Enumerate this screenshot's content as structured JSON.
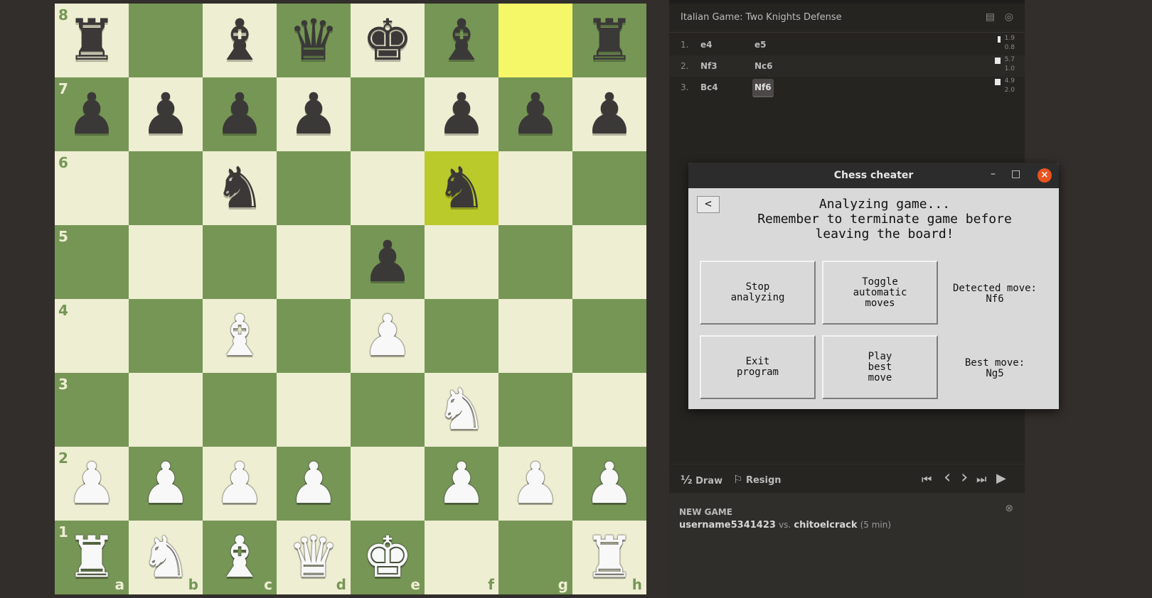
{
  "board": {
    "ranks": [
      "8",
      "7",
      "6",
      "5",
      "4",
      "3",
      "2",
      "1"
    ],
    "files": [
      "a",
      "b",
      "c",
      "d",
      "e",
      "f",
      "g",
      "h"
    ],
    "rows": [
      [
        "bR",
        "",
        "bB",
        "bQ",
        "bK",
        "bB",
        "",
        "bR"
      ],
      [
        "bP",
        "bP",
        "bP",
        "bP",
        "",
        "bP",
        "bP",
        "bP"
      ],
      [
        "",
        "",
        "bN",
        "",
        "",
        "bN",
        "",
        ""
      ],
      [
        "",
        "",
        "",
        "",
        "bP",
        "",
        "",
        ""
      ],
      [
        "",
        "",
        "wB",
        "",
        "wP",
        "",
        "",
        ""
      ],
      [
        "",
        "",
        "",
        "",
        "",
        "wN",
        "",
        ""
      ],
      [
        "wP",
        "wP",
        "wP",
        "wP",
        "",
        "wP",
        "wP",
        "wP"
      ],
      [
        "wR",
        "wN",
        "wB",
        "wQ",
        "wK",
        "",
        "",
        "wR"
      ]
    ],
    "highlight": [
      "g8",
      "f6"
    ],
    "colors": {
      "light": "#eeeed2",
      "dark": "#769656",
      "hl_light": "#f6f669",
      "hl_dark": "#baca2b"
    },
    "glyphs": {
      "K": "♚",
      "Q": "♛",
      "R": "♜",
      "B": "♝",
      "N": "♞",
      "P": "♟"
    }
  },
  "panel": {
    "opening": "Italian Game: Two Knights Defense",
    "icons": [
      "book-icon",
      "compass-icon"
    ],
    "moves": [
      {
        "num": "1.",
        "white": "e4",
        "black": "e5",
        "t1": "1.9",
        "t2": "0.8"
      },
      {
        "num": "2.",
        "white": "Nf3",
        "black": "Nc6",
        "t1": "5.7",
        "t2": "1.0"
      },
      {
        "num": "3.",
        "white": "Bc4",
        "black": "Nf6",
        "t1": "4.9",
        "t2": "2.0"
      }
    ],
    "draw": "Draw",
    "draw_icon": "½",
    "resign": "Resign",
    "resign_icon": "⚐",
    "nav_glyphs": {
      "first": "⏮",
      "prev": "‹",
      "next": "›",
      "last": "⏭",
      "play": "▶"
    }
  },
  "new_game": {
    "title": "NEW GAME",
    "player1": "username5341423",
    "vs": "vs.",
    "player2": "chitoelcrack",
    "time": "(5 min)",
    "close_glyph": "⊗"
  },
  "window": {
    "title": "Chess cheater",
    "minimize": "–",
    "maximize": "□",
    "close": "×",
    "back": "<",
    "status_line1": "Analyzing game...",
    "status_line2": "Remember to terminate game before",
    "status_line3": "leaving the board!",
    "stop_btn": "Stop\nanalyzing",
    "toggle_btn": "Toggle\nautomatic\nmoves",
    "exit_btn": "Exit\nprogram",
    "play_btn": "Play\nbest\nmove",
    "detected_label": "Detected move:",
    "detected_value": "Nf6",
    "best_label": "Best move:",
    "best_value": "Ng5"
  }
}
